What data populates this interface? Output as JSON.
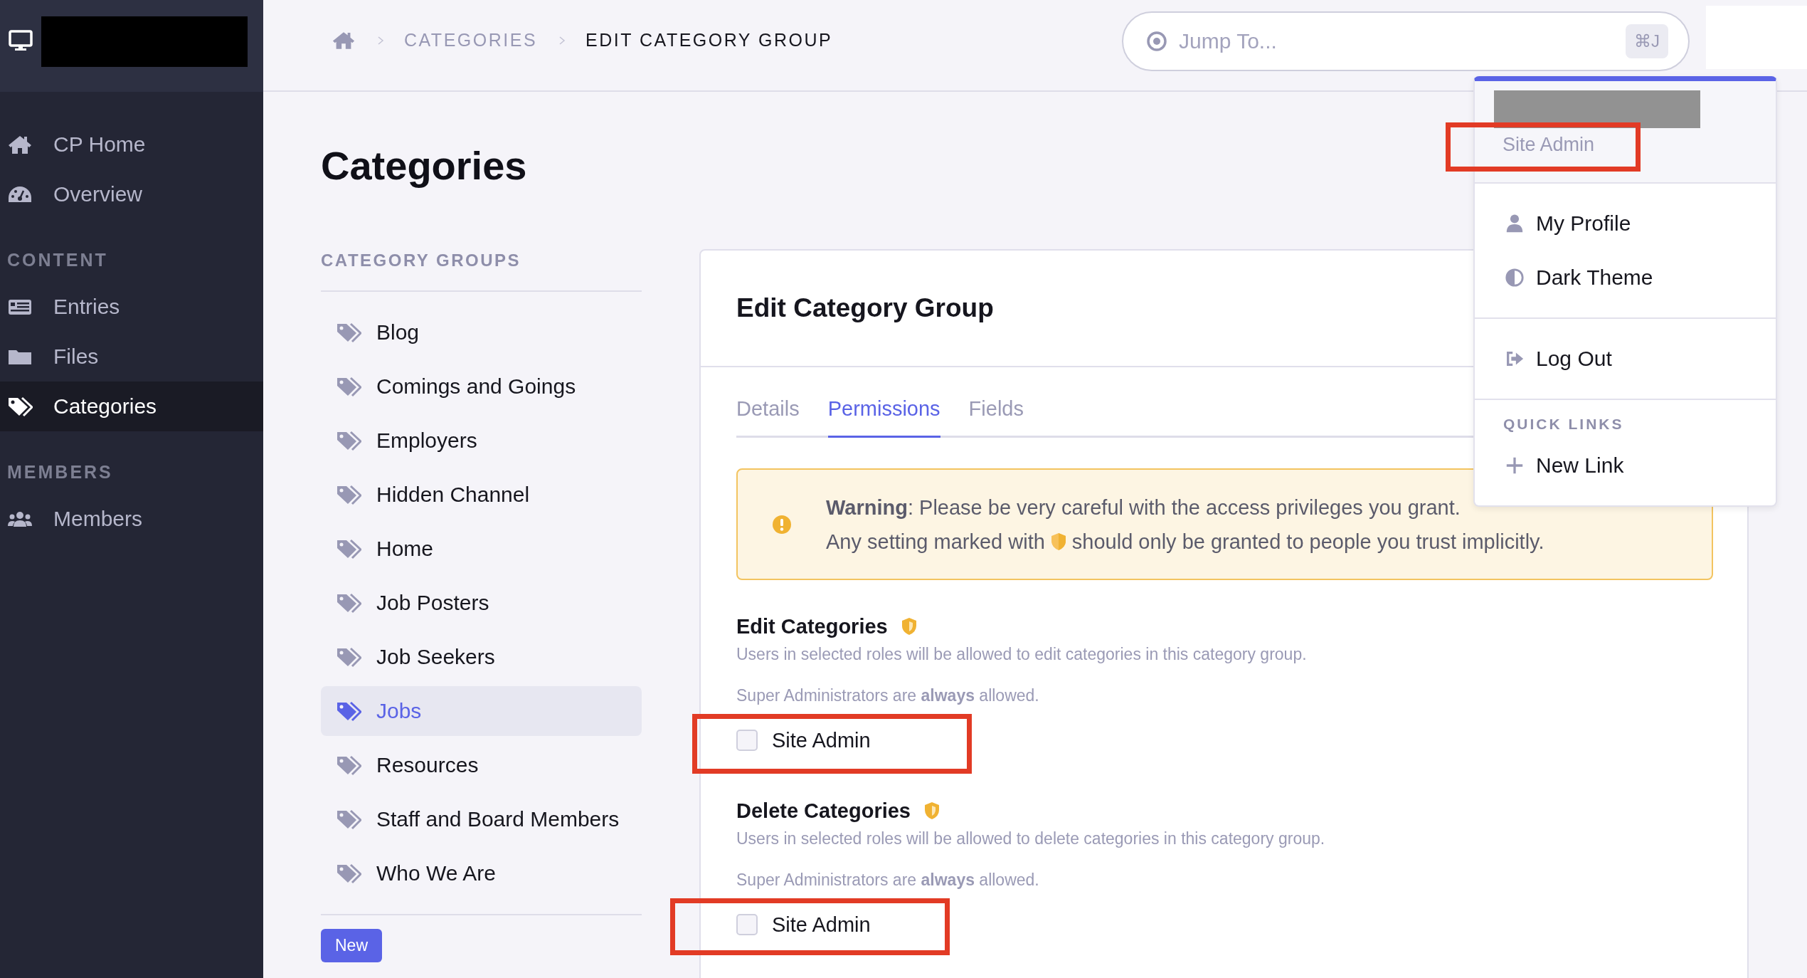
{
  "sidebar": {
    "groups": [
      {
        "items": [
          {
            "label": "CP Home",
            "selected": false
          },
          {
            "label": "Overview",
            "selected": false
          }
        ]
      },
      {
        "heading": "CONTENT",
        "items": [
          {
            "label": "Entries",
            "selected": false
          },
          {
            "label": "Files",
            "selected": false
          },
          {
            "label": "Categories",
            "selected": true
          }
        ]
      },
      {
        "heading": "MEMBERS",
        "items": [
          {
            "label": "Members",
            "selected": false
          }
        ]
      }
    ]
  },
  "breadcrumb": [
    {
      "label": "CATEGORIES",
      "current": false
    },
    {
      "label": "EDIT CATEGORY GROUP",
      "current": true
    }
  ],
  "search": {
    "placeholder": "Jump To...",
    "shortcut": "⌘J"
  },
  "user_menu": {
    "role": "Site Admin",
    "sections": [
      {
        "items": [
          {
            "label": "My Profile"
          },
          {
            "label": "Dark Theme"
          }
        ]
      },
      {
        "items": [
          {
            "label": "Log Out"
          }
        ]
      },
      {
        "heading": "QUICK LINKS",
        "items": [
          {
            "label": "New Link"
          }
        ]
      }
    ]
  },
  "page_title": "Categories",
  "category_groups": {
    "heading": "CATEGORY GROUPS",
    "items": [
      {
        "label": "Blog",
        "selected": false
      },
      {
        "label": "Comings and Goings",
        "selected": false
      },
      {
        "label": "Employers",
        "selected": false
      },
      {
        "label": "Hidden Channel",
        "selected": false
      },
      {
        "label": "Home",
        "selected": false
      },
      {
        "label": "Job Posters",
        "selected": false
      },
      {
        "label": "Job Seekers",
        "selected": false
      },
      {
        "label": "Jobs",
        "selected": true
      },
      {
        "label": "Resources",
        "selected": false
      },
      {
        "label": "Staff and Board Members",
        "selected": false
      },
      {
        "label": "Who We Are",
        "selected": false
      }
    ],
    "new_button": "New"
  },
  "card": {
    "title": "Edit Category Group",
    "tabs": [
      {
        "label": "Details",
        "selected": false
      },
      {
        "label": "Permissions",
        "selected": true
      },
      {
        "label": "Fields",
        "selected": false
      }
    ],
    "warning": {
      "text": "**Warning**: Please be very careful with the access privileges you grant.",
      "note_before_icon": "Any setting marked with",
      "note_after_icon": "should only be granted to people you trust implicitly."
    },
    "permissions": [
      {
        "title": "Edit Categories",
        "description": "Users in selected roles will be allowed to edit categories in this category group.",
        "note": "Super Administrators are **always** allowed.",
        "options": [
          {
            "label": "Site Admin",
            "checked": false
          }
        ]
      },
      {
        "title": "Delete Categories",
        "description": "Users in selected roles will be allowed to delete categories in this category group.",
        "note": "Super Administrators are **always** allowed.",
        "options": [
          {
            "label": "Site Admin",
            "checked": false
          }
        ]
      }
    ]
  }
}
